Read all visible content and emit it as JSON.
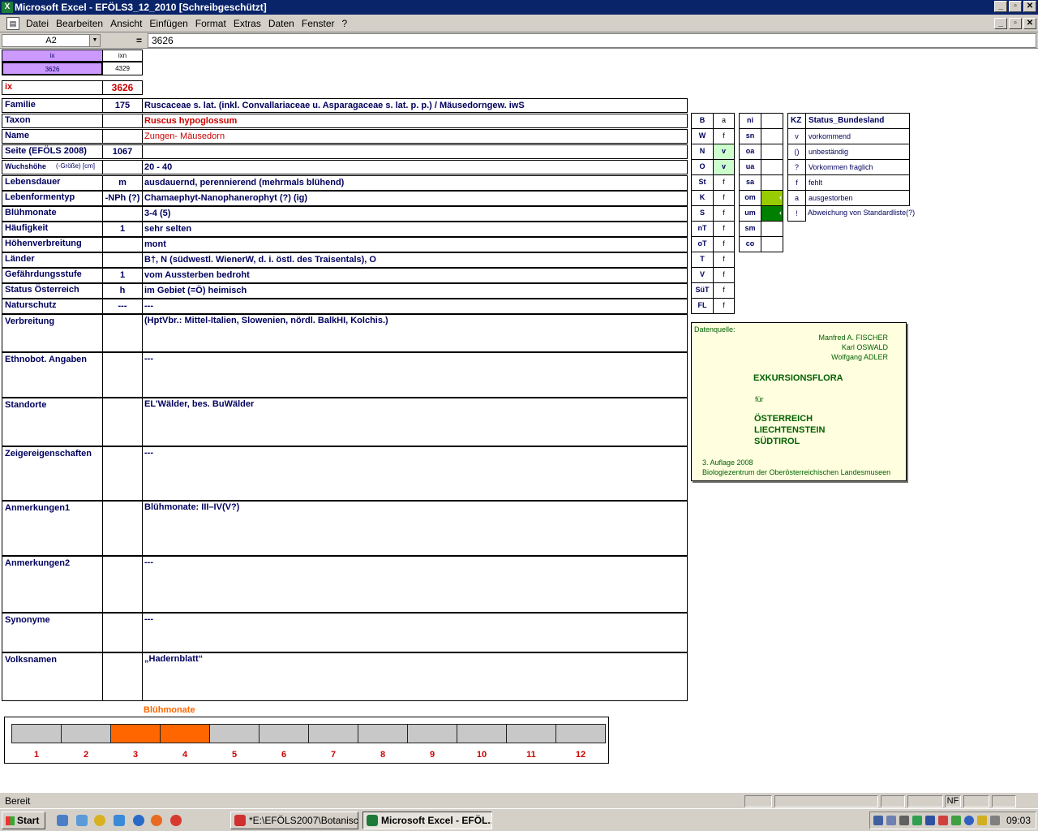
{
  "window": {
    "title": "Microsoft Excel - EFÖLS3_12_2010  [Schreibgeschützt]",
    "min": "_",
    "max": "▫",
    "close": "✕"
  },
  "menu": [
    "Datei",
    "Bearbeiten",
    "Ansicht",
    "Einfügen",
    "Format",
    "Extras",
    "Daten",
    "Fenster",
    "?"
  ],
  "formula": {
    "namebox": "A2",
    "eq": "=",
    "content": "3626"
  },
  "top": {
    "ix_head": "ix",
    "ixn_head": "ixn",
    "ix_val": "3626",
    "ixn_val": "4329",
    "ix_label": "ix",
    "ix_big": "3626"
  },
  "rows": [
    {
      "label": "Familie",
      "code": "175",
      "text": "Ruscaceae s. lat. (inkl. Convallariaceae u. Asparagaceae s. lat. p. p.)  /  Mäusedorngew. iwS"
    },
    {
      "label": "Taxon",
      "code": "",
      "text": "Ruscus hypoglossum"
    },
    {
      "label": "Name",
      "code": "",
      "text": "Zungen- Mäusedorn"
    },
    {
      "label": "Seite (EFÖLS 2008)",
      "code": "1067",
      "text": ""
    },
    {
      "label": "Wuchshöhe",
      "label_small": "(-Größe) [cm]",
      "code": "",
      "text": "20 - 40"
    },
    {
      "label": "Lebensdauer",
      "code": "m",
      "text": "ausdauernd, perennierend (mehrmals blühend)"
    },
    {
      "label": "Lebenformentyp",
      "code": "-NPh (?)",
      "text": "Chamaephyt-Nanophanerophyt (?) (ig)"
    },
    {
      "label": "Blühmonate",
      "code": "",
      "text": "3-4 (5)"
    },
    {
      "label": "Häufigkeit",
      "code": "1",
      "text": "sehr selten"
    },
    {
      "label": "Höhenverbreitung",
      "code": "",
      "text": "mont"
    },
    {
      "label": "Länder",
      "code": "",
      "text": "B†, N (südwestl. WienerW, d. i. östl. des Traisentals), O"
    },
    {
      "label": "Gefährdungsstufe",
      "code": "1",
      "text": "vom Aussterben bedroht"
    },
    {
      "label": "Status Österreich",
      "code": "h",
      "text": "im Gebiet (=Ö) heimisch"
    },
    {
      "label": "Naturschutz",
      "code": "---",
      "text": "---"
    },
    {
      "label": "Verbreitung",
      "code": "",
      "text": "(HptVbr.: Mittel-Italien, Slowenien, nördl. BalkHI, Kolchis.)"
    },
    {
      "label": "Ethnobot. Angaben",
      "code": "",
      "text": "---"
    },
    {
      "label": "Standorte",
      "code": "",
      "text": "EL'Wälder, bes. BuWälder"
    },
    {
      "label": "Zeigereigenschaften",
      "code": "",
      "text": "---"
    },
    {
      "label": "Anmerkungen1",
      "code": "",
      "text": "Blühmonate: III–IV(V?)"
    },
    {
      "label": "Anmerkungen2",
      "code": "",
      "text": "---"
    },
    {
      "label": "Synonyme",
      "code": "",
      "text": "---"
    },
    {
      "label": "Volksnamen",
      "code": "",
      "text": "„Hadernblatt“"
    }
  ],
  "states": [
    {
      "k": "B",
      "v": "a"
    },
    {
      "k": "W",
      "v": "f"
    },
    {
      "k": "N",
      "v": "v"
    },
    {
      "k": "O",
      "v": "v"
    },
    {
      "k": "St",
      "v": "f"
    },
    {
      "k": "K",
      "v": "f"
    },
    {
      "k": "S",
      "v": "f"
    },
    {
      "k": "nT",
      "v": "f"
    },
    {
      "k": "oT",
      "v": "f"
    },
    {
      "k": "T",
      "v": "f"
    },
    {
      "k": "V",
      "v": "f"
    },
    {
      "k": "SüT",
      "v": "f"
    },
    {
      "k": "FL",
      "v": "f"
    }
  ],
  "regions": [
    {
      "k": "ni",
      "v": ""
    },
    {
      "k": "sn",
      "v": ""
    },
    {
      "k": "oa",
      "v": ""
    },
    {
      "k": "ua",
      "v": ""
    },
    {
      "k": "sa",
      "v": ""
    },
    {
      "k": "om",
      "v": "‹"
    },
    {
      "k": "um",
      "v": "‹"
    },
    {
      "k": "sm",
      "v": ""
    },
    {
      "k": "co",
      "v": ""
    }
  ],
  "legend": {
    "head_k": "KZ",
    "head_v": "Status_Bundesland",
    "items": [
      {
        "k": "v",
        "v": "vorkommend"
      },
      {
        "k": "()",
        "v": "unbeständig"
      },
      {
        "k": "?",
        "v": "Vorkommen fraglich"
      },
      {
        "k": "f",
        "v": "fehlt"
      },
      {
        "k": "a",
        "v": "ausgestorben"
      },
      {
        "k": "!",
        "v": "Abweichung von Standardliste(?)"
      }
    ]
  },
  "source": {
    "label": "Datenquelle:",
    "authors": [
      "Manfred A. FISCHER",
      "Karl OSWALD",
      "Wolfgang ADLER"
    ],
    "title": "EXKURSIONSFLORA",
    "fuer": "für",
    "countries": [
      "ÖSTERREICH",
      "LIECHTENSTEIN",
      "SÜDTIROL"
    ],
    "edition": "3. Auflage 2008",
    "publisher": "Biologiezentrum der Oberösterreichischen Landesmuseen"
  },
  "chart_data": {
    "type": "bar",
    "title": "Blühmonate",
    "categories": [
      "1",
      "2",
      "3",
      "4",
      "5",
      "6",
      "7",
      "8",
      "9",
      "10",
      "11",
      "12"
    ],
    "values": [
      0,
      0,
      1,
      1,
      0,
      0,
      0,
      0,
      0,
      0,
      0,
      0
    ],
    "colors": {
      "on": "#ff6600",
      "off": "#c8c8c8"
    }
  },
  "status": {
    "text": "Bereit",
    "nf": "NF"
  },
  "taskbar": {
    "start": "Start",
    "tasks": [
      "*E:\\EFÖLS2007\\Botanisc...",
      "Microsoft Excel - EFÖL..."
    ],
    "clock": "09:03"
  },
  "colors": {
    "title": "#0a246a",
    "label": "#00005e",
    "red": "#cc0000",
    "violet": "#cc99ff",
    "green_light": "#ccffcc",
    "green_mid": "#99cc00",
    "green_dark": "#008000",
    "orange": "#ff6600"
  }
}
